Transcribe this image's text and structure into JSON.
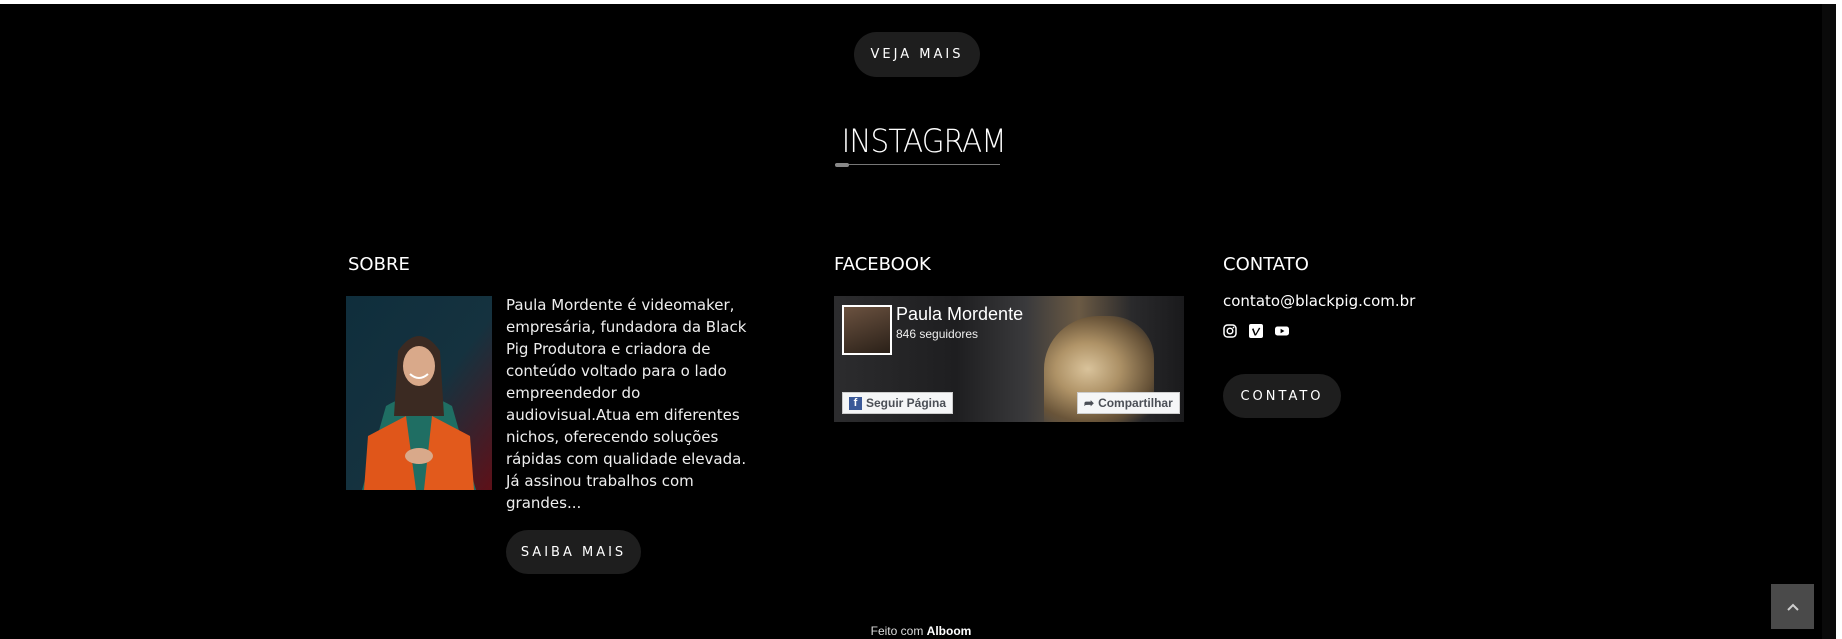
{
  "gallery": {
    "see_more_label": "VEJA MAIS"
  },
  "instagram": {
    "title": "INSTAGRAM"
  },
  "sobre": {
    "title": "SOBRE",
    "text": "Paula Mordente é videomaker, empresária, fundadora da Black Pig Produtora e criadora de conteúdo voltado para o lado empreendedor do audiovisual.Atua em diferentes nichos, oferecendo soluções rápidas com qualidade elevada. Já assinou trabalhos com grandes...",
    "button_label": "SAIBA MAIS"
  },
  "facebook": {
    "title": "FACEBOOK",
    "page_name": "Paula Mordente",
    "followers": "846 seguidores",
    "follow_label": "Seguir Página",
    "share_label": "Compartilhar"
  },
  "contato": {
    "title": "CONTATO",
    "email": "contato@blackpig.com.br",
    "socials": [
      "instagram-icon",
      "vimeo-icon",
      "youtube-icon"
    ],
    "button_label": "CONTATO"
  },
  "footer": {
    "prefix": "Feito com",
    "brand": "Alboom"
  },
  "colors": {
    "background": "#000000",
    "button": "#1e1e1e",
    "back_to_top": "#4a4a4a",
    "facebook_blue": "#3b5998"
  }
}
